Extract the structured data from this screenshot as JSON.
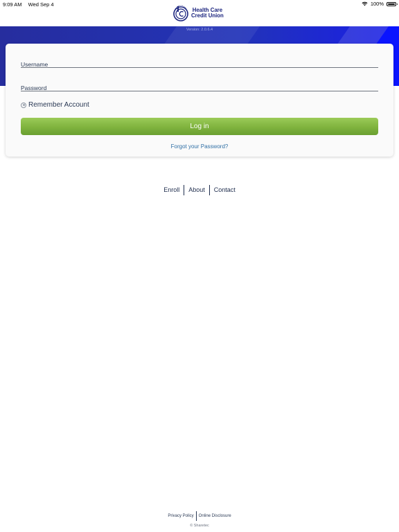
{
  "status_bar": {
    "time": "9:09 AM",
    "date": "Wed Sep 4",
    "battery": "100%",
    "battery_level": 1.0
  },
  "header": {
    "logo_line1": "Health Care",
    "logo_line2": "Credit Union",
    "logo_mark_text": "HC",
    "version": "Version: 2.0.6.4"
  },
  "login": {
    "username_placeholder": "Username",
    "password_placeholder": "Password",
    "remember_label": "Remember Account",
    "login_button": "Log in",
    "forgot_link": "Forgot your Password?"
  },
  "nav": {
    "enroll": "Enroll",
    "about": "About",
    "contact": "Contact"
  },
  "footer": {
    "privacy": "Privacy Policy",
    "disclosure": "Online Disclosure",
    "copyright": "© Sharetec"
  },
  "colors": {
    "brand_navy": "#1a237e",
    "banner_blue": "#2233b8",
    "button_green": "#7fb33e",
    "link_blue": "#2f6fa5"
  }
}
